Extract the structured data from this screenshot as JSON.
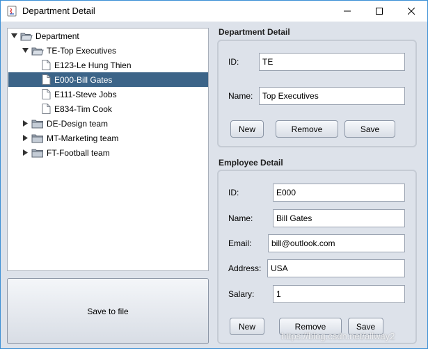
{
  "window": {
    "title": "Department Detail"
  },
  "tree": {
    "root": "Department",
    "groups": [
      {
        "label": "TE-Top Executives",
        "expanded": true,
        "children": [
          "E123-Le Hung Thien",
          "E000-Bill Gates",
          "E111-Steve Jobs",
          "E834-Tim Cook"
        ]
      },
      {
        "label": "DE-Design team",
        "expanded": false
      },
      {
        "label": "MT-Marketing team",
        "expanded": false
      },
      {
        "label": "FT-Football team",
        "expanded": false
      }
    ],
    "selected": "E000-Bill Gates"
  },
  "save_file_label": "Save to file",
  "department": {
    "title": "Department Detail",
    "id_label": "ID:",
    "id_value": "TE",
    "name_label": "Name:",
    "name_value": "Top Executives",
    "buttons": {
      "new": "New",
      "remove": "Remove",
      "save": "Save"
    }
  },
  "employee": {
    "title": "Employee Detail",
    "id_label": "ID:",
    "id_value": "E000",
    "name_label": "Name:",
    "name_value": "Bill Gates",
    "email_label": "Email:",
    "email_value": "bill@outlook.com",
    "address_label": "Address:",
    "address_value": "USA",
    "salary_label": "Salary:",
    "salary_value": "1",
    "buttons": {
      "new": "New",
      "remove": "Remove",
      "save": "Save"
    }
  },
  "watermark": "https://blog.csdn.net/allway2",
  "colors": {
    "selection": "#3c6488",
    "window_border": "#3b8fd5",
    "panel_bg": "#dde2ea"
  }
}
